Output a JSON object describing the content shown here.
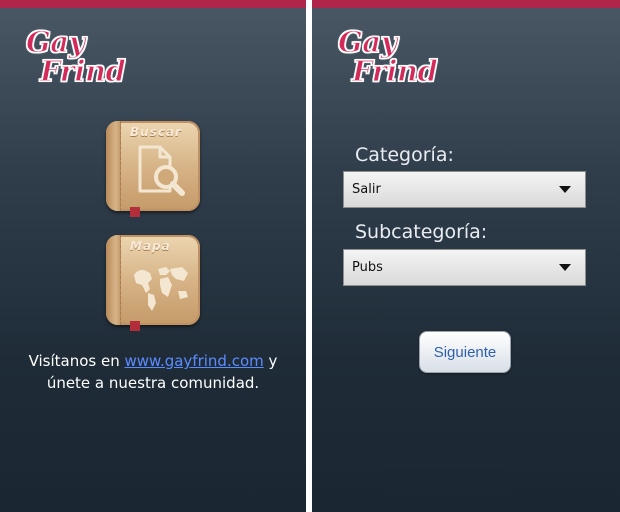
{
  "app": {
    "brand_line1": "Gay",
    "brand_line2": "Frind",
    "brand_color": "#d42a5a",
    "topbar_color": "#b0254a"
  },
  "home": {
    "buttons": [
      {
        "label": "Buscar",
        "icon": "document-search-icon"
      },
      {
        "label": "Mapa",
        "icon": "world-map-icon"
      }
    ],
    "visit_prefix": "Visítanos en",
    "visit_link": "www.gayfrind.com",
    "visit_suffix": "y",
    "visit_line2": "únete a nuestra comunidad."
  },
  "form": {
    "category_label": "Categoría:",
    "category_value": "Salir",
    "subcategory_label": "Subcategoría:",
    "subcategory_value": "Pubs",
    "next_button": "Siguiente"
  }
}
